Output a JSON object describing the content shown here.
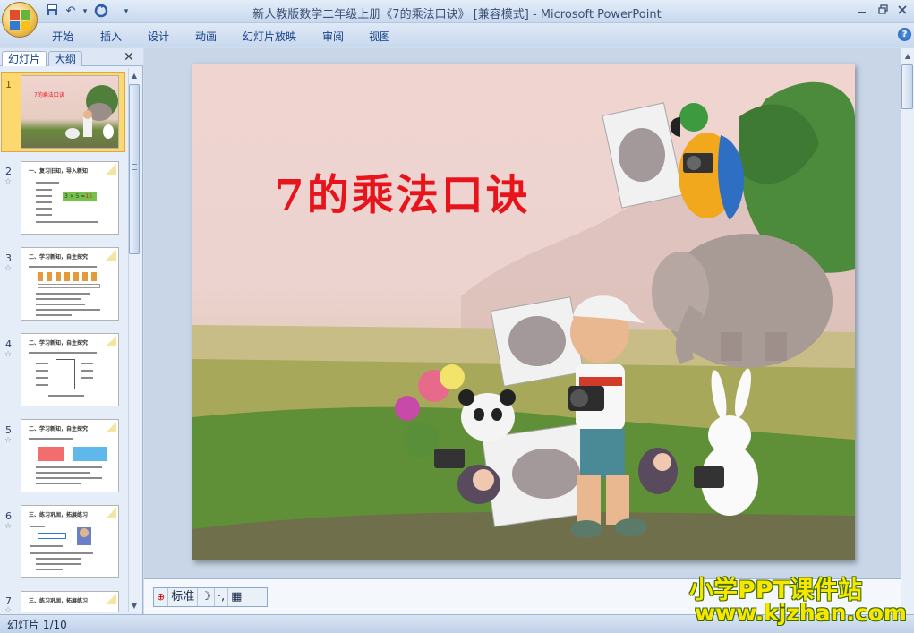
{
  "window": {
    "title": "新人教版数学二年级上册《7的乘法口诀》 [兼容模式] - Microsoft PowerPoint",
    "minimize_icon": "minimize-icon",
    "restore_icon": "restore-icon",
    "close_icon": "close-icon"
  },
  "ribbon": {
    "tabs": [
      "开始",
      "插入",
      "设计",
      "动画",
      "幻灯片放映",
      "审阅",
      "视图"
    ],
    "help_glyph": "?"
  },
  "pane": {
    "tabs": [
      "幻灯片",
      "大纲"
    ],
    "slides": [
      {
        "num": "1",
        "title": "7的乘法口诀"
      },
      {
        "num": "2",
        "title": "一、复习旧知，导入新知"
      },
      {
        "num": "3",
        "title": "二、学习新知，自主探究"
      },
      {
        "num": "4",
        "title": "二、学习新知，自主探究"
      },
      {
        "num": "5",
        "title": "二、学习新知，自主探究"
      },
      {
        "num": "6",
        "title": "三、练习巩固，拓展练习"
      },
      {
        "num": "7",
        "title": "三、练习巩固，拓展练习"
      }
    ],
    "thumb2_equation": "3 × 5 =",
    "thumb2_answer": "15"
  },
  "slide": {
    "title": "7的乘法口诀"
  },
  "viewbar": {
    "label": "标准"
  },
  "status": {
    "text": "幻灯片 1/10"
  },
  "watermark": {
    "line1": "小学PPT课件站",
    "line2": "www.kjzhan.com"
  },
  "colors": {
    "title_red": "#e8141c",
    "accent_blue": "#15428b",
    "selected_slide": "#fbd96e"
  }
}
